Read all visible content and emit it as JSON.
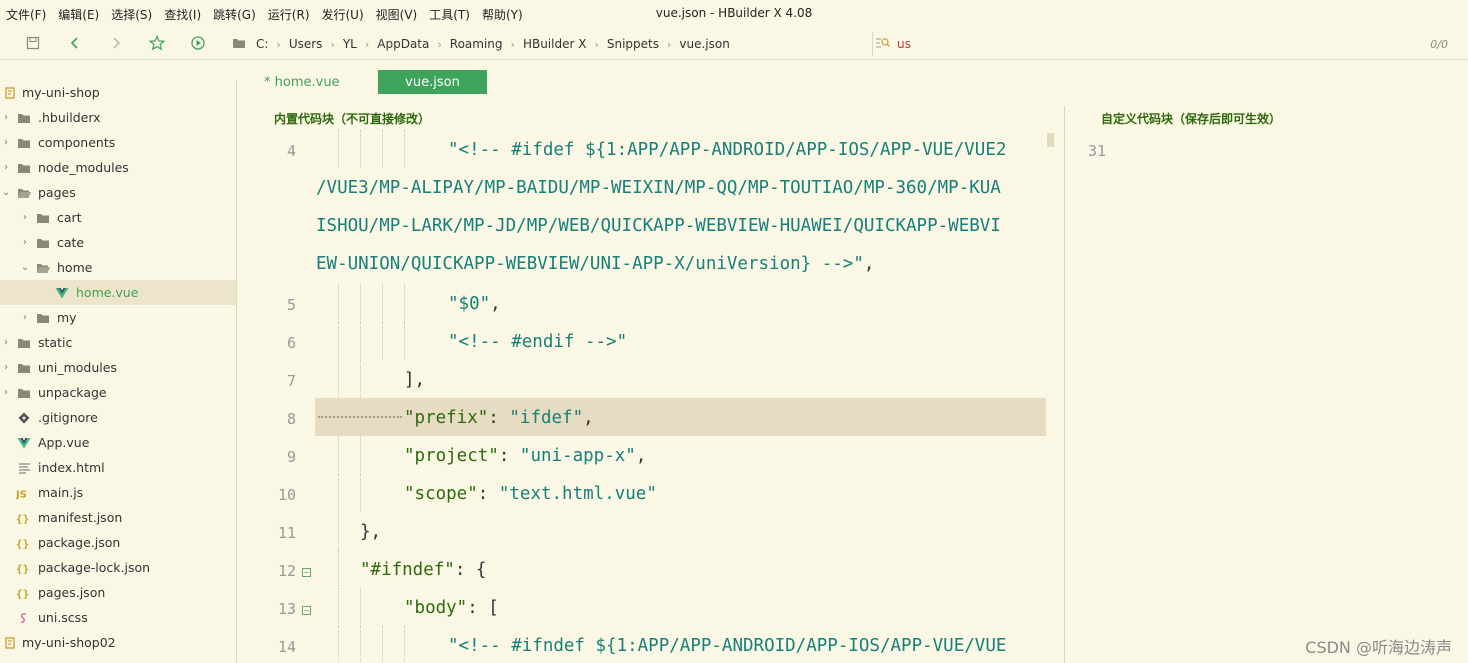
{
  "window": {
    "title": "vue.json - HBuilder X 4.08"
  },
  "menu": [
    "文件(F)",
    "编辑(E)",
    "选择(S)",
    "查找(I)",
    "跳转(G)",
    "运行(R)",
    "发行(U)",
    "视图(V)",
    "工具(T)",
    "帮助(Y)"
  ],
  "breadcrumb": [
    "C:",
    "Users",
    "YL",
    "AppData",
    "Roaming",
    "HBuilder X",
    "Snippets",
    "vue.json"
  ],
  "search": {
    "value": "us",
    "count": "0/0"
  },
  "sidebar": {
    "items": [
      {
        "label": "my-uni-shop",
        "icon": "project-icon"
      },
      {
        "label": ".hbuilderx",
        "icon": "folder-icon"
      },
      {
        "label": "components",
        "icon": "folder-icon"
      },
      {
        "label": "node_modules",
        "icon": "folder-icon"
      },
      {
        "label": "pages",
        "icon": "folder-open-icon"
      },
      {
        "label": "cart",
        "icon": "folder-icon"
      },
      {
        "label": "cate",
        "icon": "folder-icon"
      },
      {
        "label": "home",
        "icon": "folder-open-icon"
      },
      {
        "label": "home.vue",
        "icon": "vue-icon"
      },
      {
        "label": "my",
        "icon": "folder-icon"
      },
      {
        "label": "static",
        "icon": "folder-icon"
      },
      {
        "label": "uni_modules",
        "icon": "folder-icon"
      },
      {
        "label": "unpackage",
        "icon": "folder-icon"
      },
      {
        "label": ".gitignore",
        "icon": "git-icon"
      },
      {
        "label": "App.vue",
        "icon": "vue-icon"
      },
      {
        "label": "index.html",
        "icon": "html-icon"
      },
      {
        "label": "main.js",
        "icon": "js-icon"
      },
      {
        "label": "manifest.json",
        "icon": "json-icon"
      },
      {
        "label": "package.json",
        "icon": "json-icon"
      },
      {
        "label": "package-lock.json",
        "icon": "json-icon"
      },
      {
        "label": "pages.json",
        "icon": "json-icon"
      },
      {
        "label": "uni.scss",
        "icon": "scss-icon"
      },
      {
        "label": "my-uni-shop02",
        "icon": "project-icon"
      }
    ]
  },
  "tabs": [
    {
      "label": "* home.vue"
    },
    {
      "label": "vue.json"
    }
  ],
  "panes": {
    "builtin_title": "内置代码块（不可直接修改）",
    "custom_title": "自定义代码块（保存后即可生效）",
    "custom_line_number": "31"
  },
  "code": {
    "line_numbers": [
      "4",
      "5",
      "6",
      "7",
      "8",
      "9",
      "10",
      "11",
      "12",
      "13",
      "14"
    ],
    "l4_a": "\"<!-- #ifdef ${1:APP/APP-ANDROID/APP-IOS/APP-VUE/VUE2",
    "l4_b": "/VUE3/MP-ALIPAY/MP-BAIDU/MP-WEIXIN/MP-QQ/MP-TOUTIAO/MP-360/MP-KUA",
    "l4_c": "ISHOU/MP-LARK/MP-JD/MP/WEB/QUICKAPP-WEBVIEW-HUAWEI/QUICKAPP-WEBVI",
    "l4_d": "EW-UNION/QUICKAPP-WEBVIEW/UNI-APP-X/uniVersion} -->\"",
    "l4_d_end": ",",
    "l5": "\"$0\"",
    "l5_end": ",",
    "l6": "\"<!-- #endif -->\"",
    "l7": "],",
    "l8_key": "\"prefix\"",
    "l8_colon": ": ",
    "l8_val": "\"ifdef\"",
    "l8_end": ",",
    "l9_key": "\"project\"",
    "l9_colon": ": ",
    "l9_val": "\"uni-app-x\"",
    "l9_end": ",",
    "l10_key": "\"scope\"",
    "l10_colon": ": ",
    "l10_val": "\"text.html.vue\"",
    "l11": "},",
    "l12_key": "\"#ifndef\"",
    "l12_rest": ": {",
    "l13_key": "\"body\"",
    "l13_rest": ": [",
    "l14": "\"<!-- #ifndef ${1:APP/APP-ANDROID/APP-IOS/APP-VUE/VUE"
  },
  "watermark": "CSDN @听海边涛声"
}
